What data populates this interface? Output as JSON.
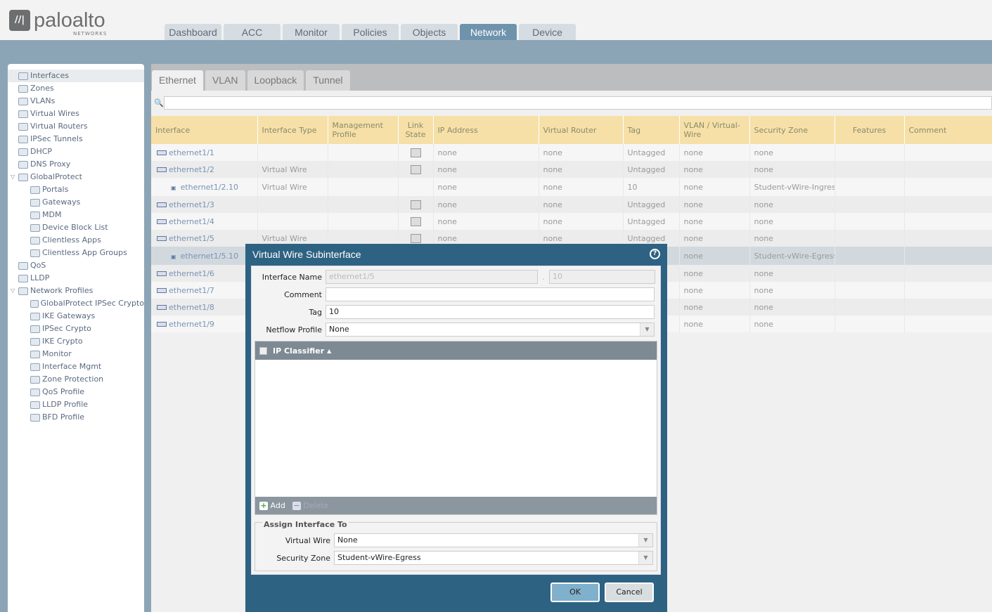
{
  "brand": {
    "name": "paloalto",
    "sub": "NETWORKS"
  },
  "nav_tabs": [
    "Dashboard",
    "ACC",
    "Monitor",
    "Policies",
    "Objects",
    "Network",
    "Device"
  ],
  "active_nav": "Network",
  "sidebar": [
    {
      "label": "Interfaces",
      "level": 0,
      "selected": true
    },
    {
      "label": "Zones",
      "level": 0
    },
    {
      "label": "VLANs",
      "level": 0
    },
    {
      "label": "Virtual Wires",
      "level": 0
    },
    {
      "label": "Virtual Routers",
      "level": 0
    },
    {
      "label": "IPSec Tunnels",
      "level": 0
    },
    {
      "label": "DHCP",
      "level": 0
    },
    {
      "label": "DNS Proxy",
      "level": 0
    },
    {
      "label": "GlobalProtect",
      "level": 0,
      "expanded": true
    },
    {
      "label": "Portals",
      "level": 1
    },
    {
      "label": "Gateways",
      "level": 1
    },
    {
      "label": "MDM",
      "level": 1
    },
    {
      "label": "Device Block List",
      "level": 1
    },
    {
      "label": "Clientless Apps",
      "level": 1
    },
    {
      "label": "Clientless App Groups",
      "level": 1
    },
    {
      "label": "QoS",
      "level": 0
    },
    {
      "label": "LLDP",
      "level": 0
    },
    {
      "label": "Network Profiles",
      "level": 0,
      "expanded": true
    },
    {
      "label": "GlobalProtect IPSec Crypto",
      "level": 1
    },
    {
      "label": "IKE Gateways",
      "level": 1
    },
    {
      "label": "IPSec Crypto",
      "level": 1
    },
    {
      "label": "IKE Crypto",
      "level": 1
    },
    {
      "label": "Monitor",
      "level": 1
    },
    {
      "label": "Interface Mgmt",
      "level": 1
    },
    {
      "label": "Zone Protection",
      "level": 1
    },
    {
      "label": "QoS Profile",
      "level": 1
    },
    {
      "label": "LLDP Profile",
      "level": 1
    },
    {
      "label": "BFD Profile",
      "level": 1
    }
  ],
  "sub_tabs": [
    "Ethernet",
    "VLAN",
    "Loopback",
    "Tunnel"
  ],
  "table": {
    "columns": [
      "Interface",
      "Interface Type",
      "Management Profile",
      "Link State",
      "IP Address",
      "Virtual Router",
      "Tag",
      "VLAN / Virtual-Wire",
      "Security Zone",
      "Features",
      "Comment"
    ],
    "rows": [
      [
        "ethernet1/1",
        "",
        "",
        "link",
        "none",
        "none",
        "Untagged",
        "none",
        "none",
        "",
        ""
      ],
      [
        "ethernet1/2",
        "Virtual Wire",
        "",
        "link",
        "none",
        "none",
        "Untagged",
        "none",
        "none",
        "",
        ""
      ],
      [
        "ethernet1/2.10",
        "Virtual Wire",
        "",
        "",
        "none",
        "none",
        "10",
        "none",
        "Student-vWire-Ingress",
        "",
        ""
      ],
      [
        "ethernet1/3",
        "",
        "",
        "link",
        "none",
        "none",
        "Untagged",
        "none",
        "none",
        "",
        ""
      ],
      [
        "ethernet1/4",
        "",
        "",
        "link",
        "none",
        "none",
        "Untagged",
        "none",
        "none",
        "",
        ""
      ],
      [
        "ethernet1/5",
        "Virtual Wire",
        "",
        "link",
        "none",
        "none",
        "Untagged",
        "none",
        "none",
        "",
        ""
      ],
      [
        "ethernet1/5.10",
        "",
        "",
        "",
        "",
        "",
        "",
        "none",
        "Student-vWire-Egress",
        "",
        ""
      ],
      [
        "ethernet1/6",
        "",
        "",
        "",
        "",
        "",
        "",
        "none",
        "none",
        "",
        ""
      ],
      [
        "ethernet1/7",
        "",
        "",
        "",
        "",
        "",
        "",
        "none",
        "none",
        "",
        ""
      ],
      [
        "ethernet1/8",
        "",
        "",
        "",
        "",
        "",
        "",
        "none",
        "none",
        "",
        ""
      ],
      [
        "ethernet1/9",
        "",
        "",
        "",
        "",
        "",
        "",
        "none",
        "none",
        "",
        ""
      ]
    ]
  },
  "modal": {
    "title": "Virtual Wire Subinterface",
    "interface_name_label": "Interface Name",
    "interface_name": "ethernet1/5",
    "sub_sep": ".",
    "sub_id": "10",
    "comment_label": "Comment",
    "comment": "",
    "tag_label": "Tag",
    "tag": "10",
    "netflow_label": "Netflow Profile",
    "netflow": "None",
    "ip_classifier_header": "IP Classifier",
    "add": "Add",
    "delete": "Delete",
    "assign_legend": "Assign Interface To",
    "vwire_label": "Virtual Wire",
    "vwire": "None",
    "zone_label": "Security Zone",
    "zone": "Student-vWire-Egress",
    "ok": "OK",
    "cancel": "Cancel"
  }
}
